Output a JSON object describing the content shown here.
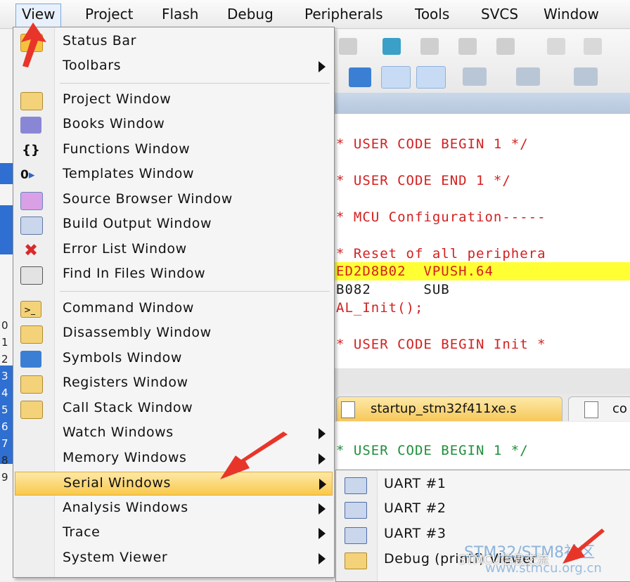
{
  "menubar": {
    "items": [
      "View",
      "Project",
      "Flash",
      "Debug",
      "Peripherals",
      "Tools",
      "SVCS",
      "Window"
    ]
  },
  "view_menu": {
    "items": [
      {
        "label": "Status Bar",
        "icon": "star-check-icon",
        "submenu": false
      },
      {
        "label": "Toolbars",
        "icon": "",
        "submenu": true
      },
      {
        "label": "Project Window",
        "icon": "project-window-icon",
        "submenu": false
      },
      {
        "label": "Books Window",
        "icon": "books-icon",
        "submenu": false
      },
      {
        "label": "Functions Window",
        "icon": "braces-icon",
        "submenu": false
      },
      {
        "label": "Templates Window",
        "icon": "templates-icon",
        "submenu": false
      },
      {
        "label": "Source Browser Window",
        "icon": "source-browser-icon",
        "submenu": false
      },
      {
        "label": "Build Output Window",
        "icon": "build-output-icon",
        "submenu": false
      },
      {
        "label": "Error List Window",
        "icon": "error-x-icon",
        "submenu": false
      },
      {
        "label": "Find In Files Window",
        "icon": "find-in-files-icon",
        "submenu": false
      },
      {
        "label": "Command Window",
        "icon": "command-prompt-icon",
        "submenu": false
      },
      {
        "label": "Disassembly Window",
        "icon": "disassembly-icon",
        "submenu": false
      },
      {
        "label": "Symbols Window",
        "icon": "symbols-icon",
        "submenu": false
      },
      {
        "label": "Registers Window",
        "icon": "registers-icon",
        "submenu": false
      },
      {
        "label": "Call Stack Window",
        "icon": "call-stack-icon",
        "submenu": false
      },
      {
        "label": "Watch Windows",
        "icon": "",
        "submenu": true
      },
      {
        "label": "Memory Windows",
        "icon": "",
        "submenu": true
      },
      {
        "label": "Serial Windows",
        "icon": "",
        "submenu": true
      },
      {
        "label": "Analysis Windows",
        "icon": "",
        "submenu": true
      },
      {
        "label": "Trace",
        "icon": "",
        "submenu": true
      },
      {
        "label": "System Viewer",
        "icon": "",
        "submenu": true
      }
    ]
  },
  "serial_submenu": {
    "items": [
      "UART #1",
      "UART #2",
      "UART #3",
      "Debug (printf) Viewer"
    ]
  },
  "editor_top": {
    "lines": [
      "* USER CODE BEGIN 1 */",
      "* USER CODE END 1 */",
      "* MCU Configuration-----",
      "* Reset of all periphera",
      "ED2D8B02  VPUSH.64",
      "B082      SUB",
      "AL_Init();",
      "* USER CODE BEGIN Init *"
    ]
  },
  "editor_tabs": [
    "startup_stm32f411xe.s",
    "co"
  ],
  "editor_bottom": {
    "lines": [
      "* USER CODE BEGIN 1 */"
    ]
  },
  "left_gutter": [
    "0",
    "1",
    "2",
    "3",
    "4",
    "5",
    "6",
    "7",
    "8",
    "9"
  ],
  "watermark": {
    "line1": "STM32/STM8社区",
    "line2": "www.stmcu.org.cn",
    "overlay": "STMCU信息交流"
  },
  "colors": {
    "menu_highlight": "#f9c94b",
    "code_red": "#d32020",
    "code_green": "#1f8f3a",
    "asm_highlight": "#ffff33",
    "annotation_arrow": "#e8352a"
  }
}
